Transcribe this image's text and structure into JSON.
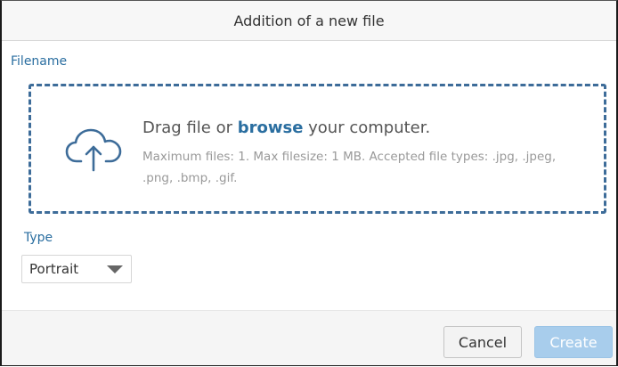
{
  "dialog": {
    "title": "Addition of a new file"
  },
  "filename": {
    "label": "Filename",
    "dropzone": {
      "prefix": "Drag file or ",
      "browse_link": "browse",
      "suffix": " your computer.",
      "hint": "Maximum files: 1. Max filesize: 1 MB. Accepted file types: .jpg, .jpeg, .png, .bmp, .gif.",
      "icon": "cloud-upload-icon"
    }
  },
  "type": {
    "label": "Type",
    "selected": "Portrait"
  },
  "footer": {
    "cancel_label": "Cancel",
    "create_label": "Create"
  },
  "colors": {
    "accent": "#2a6ea0",
    "dropzone_border": "#3d6c99",
    "create_button_disabled": "#a8cdec"
  }
}
